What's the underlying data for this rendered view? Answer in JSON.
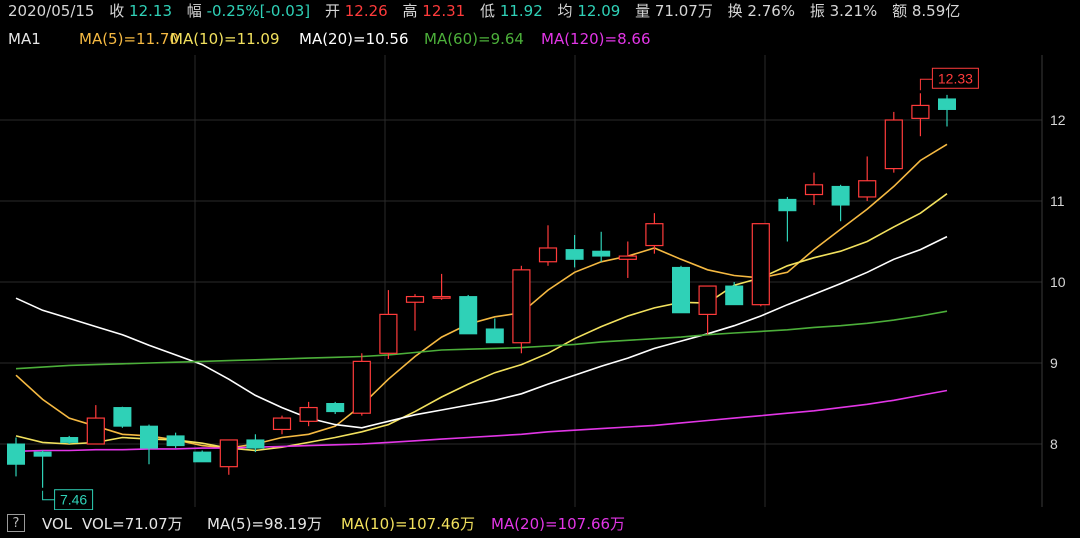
{
  "header": {
    "date": "2020/05/15",
    "close_label": "收",
    "close": "12.13",
    "change_label": "幅",
    "change": "-0.25%[-0.03]",
    "open_label": "开",
    "open": "12.26",
    "high_label": "高",
    "high": "12.31",
    "low_label": "低",
    "low": "11.92",
    "avg_label": "均",
    "avg": "12.09",
    "volume_label": "量",
    "volume": "71.07万",
    "turnover_label": "换",
    "turnover": "2.76%",
    "amplitude_label": "振",
    "amplitude": "3.21%",
    "amount_label": "额",
    "amount": "8.59亿"
  },
  "ma_row": {
    "name": "MA1",
    "ma5": "MA(5)=11.70",
    "ma10": "MA(10)=11.09",
    "ma20": "MA(20)=10.56",
    "ma60": "MA(60)=9.64",
    "ma120": "MA(120)=8.66"
  },
  "vol_row": {
    "help": "?",
    "name": "VOL",
    "vol": "VOL=71.07万",
    "ma5": "MA(5)=98.19万",
    "ma10": "MA(10)=107.46万",
    "ma20": "MA(20)=107.66万"
  },
  "colors": {
    "up": "#ff3b3b",
    "down": "#2fd1b7",
    "ma5": "#f5b942",
    "ma10": "#f2e15e",
    "ma20": "#ffffff",
    "ma60": "#4caf3a",
    "ma120": "#e236e6",
    "grid": "#2a2a2a"
  },
  "chart_data": {
    "type": "candlestick",
    "y_ticks": [
      "8",
      "9",
      "10",
      "11",
      "12"
    ],
    "ylim": [
      7.15,
      12.9
    ],
    "max_marker": "12.33",
    "min_marker": "7.46",
    "candles": [
      {
        "o": 8.0,
        "h": 8.08,
        "l": 7.6,
        "c": 7.75
      },
      {
        "o": 7.9,
        "h": 7.92,
        "l": 7.46,
        "c": 7.85
      },
      {
        "o": 8.08,
        "h": 8.1,
        "l": 8.0,
        "c": 8.02
      },
      {
        "o": 8.0,
        "h": 8.48,
        "l": 8.0,
        "c": 8.32
      },
      {
        "o": 8.45,
        "h": 8.46,
        "l": 8.2,
        "c": 8.22
      },
      {
        "o": 8.22,
        "h": 8.24,
        "l": 7.75,
        "c": 7.95
      },
      {
        "o": 8.1,
        "h": 8.14,
        "l": 7.95,
        "c": 7.98
      },
      {
        "o": 7.9,
        "h": 7.92,
        "l": 7.78,
        "c": 7.78
      },
      {
        "o": 7.72,
        "h": 8.05,
        "l": 7.62,
        "c": 8.05
      },
      {
        "o": 8.05,
        "h": 8.12,
        "l": 7.9,
        "c": 7.95
      },
      {
        "o": 8.18,
        "h": 8.35,
        "l": 8.12,
        "c": 8.32
      },
      {
        "o": 8.28,
        "h": 8.52,
        "l": 8.22,
        "c": 8.45
      },
      {
        "o": 8.5,
        "h": 8.52,
        "l": 8.37,
        "c": 8.4
      },
      {
        "o": 8.38,
        "h": 9.12,
        "l": 8.35,
        "c": 9.02
      },
      {
        "o": 9.12,
        "h": 9.9,
        "l": 9.05,
        "c": 9.6
      },
      {
        "o": 9.75,
        "h": 9.85,
        "l": 9.4,
        "c": 9.82
      },
      {
        "o": 9.8,
        "h": 10.1,
        "l": 9.78,
        "c": 9.82
      },
      {
        "o": 9.82,
        "h": 9.84,
        "l": 9.36,
        "c": 9.36
      },
      {
        "o": 9.42,
        "h": 9.55,
        "l": 9.28,
        "c": 9.25
      },
      {
        "o": 9.25,
        "h": 10.2,
        "l": 9.12,
        "c": 10.15
      },
      {
        "o": 10.25,
        "h": 10.7,
        "l": 10.2,
        "c": 10.42
      },
      {
        "o": 10.4,
        "h": 10.58,
        "l": 10.18,
        "c": 10.28
      },
      {
        "o": 10.38,
        "h": 10.62,
        "l": 10.25,
        "c": 10.32
      },
      {
        "o": 10.28,
        "h": 10.5,
        "l": 10.05,
        "c": 10.32
      },
      {
        "o": 10.45,
        "h": 10.85,
        "l": 10.35,
        "c": 10.72
      },
      {
        "o": 10.18,
        "h": 10.2,
        "l": 9.62,
        "c": 9.62
      },
      {
        "o": 9.6,
        "h": 9.95,
        "l": 9.35,
        "c": 9.95
      },
      {
        "o": 9.95,
        "h": 10.0,
        "l": 9.72,
        "c": 9.72
      },
      {
        "o": 9.72,
        "h": 10.72,
        "l": 9.7,
        "c": 10.72
      },
      {
        "o": 11.02,
        "h": 11.05,
        "l": 10.5,
        "c": 10.88
      },
      {
        "o": 11.08,
        "h": 11.35,
        "l": 10.95,
        "c": 11.2
      },
      {
        "o": 11.18,
        "h": 11.2,
        "l": 10.75,
        "c": 10.95
      },
      {
        "o": 11.05,
        "h": 11.55,
        "l": 11.0,
        "c": 11.25
      },
      {
        "o": 11.4,
        "h": 12.1,
        "l": 11.35,
        "c": 12.0
      },
      {
        "o": 12.02,
        "h": 12.33,
        "l": 11.8,
        "c": 12.18
      },
      {
        "o": 12.26,
        "h": 12.31,
        "l": 11.92,
        "c": 12.13
      }
    ],
    "series": [
      {
        "name": "MA(5)",
        "key": "ma5",
        "values": [
          8.85,
          8.55,
          8.32,
          8.22,
          8.12,
          8.1,
          8.05,
          7.98,
          7.95,
          8.0,
          8.08,
          8.12,
          8.22,
          8.48,
          8.8,
          9.08,
          9.32,
          9.48,
          9.57,
          9.62,
          9.9,
          10.12,
          10.25,
          10.32,
          10.42,
          10.28,
          10.15,
          10.08,
          10.05,
          10.12,
          10.4,
          10.65,
          10.9,
          11.18,
          11.5,
          11.7
        ]
      },
      {
        "name": "MA(10)",
        "key": "ma10",
        "values": [
          8.1,
          8.02,
          8.0,
          8.02,
          8.08,
          8.06,
          8.05,
          8.01,
          7.95,
          7.92,
          7.96,
          8.02,
          8.08,
          8.15,
          8.24,
          8.4,
          8.58,
          8.74,
          8.88,
          8.98,
          9.12,
          9.3,
          9.45,
          9.58,
          9.68,
          9.75,
          9.74,
          9.96,
          10.05,
          10.2,
          10.3,
          10.38,
          10.5,
          10.68,
          10.85,
          11.09
        ]
      },
      {
        "name": "MA(20)",
        "key": "ma20",
        "values": [
          9.8,
          9.65,
          9.55,
          9.45,
          9.35,
          9.22,
          9.1,
          8.98,
          8.8,
          8.6,
          8.45,
          8.32,
          8.24,
          8.2,
          8.28,
          8.36,
          8.42,
          8.48,
          8.54,
          8.62,
          8.74,
          8.85,
          8.96,
          9.06,
          9.18,
          9.27,
          9.36,
          9.46,
          9.58,
          9.72,
          9.85,
          9.98,
          10.12,
          10.28,
          10.4,
          10.56
        ]
      },
      {
        "name": "MA(60)",
        "key": "ma60",
        "values": [
          8.93,
          8.95,
          8.97,
          8.98,
          8.99,
          9.0,
          9.01,
          9.02,
          9.03,
          9.04,
          9.05,
          9.06,
          9.07,
          9.08,
          9.1,
          9.13,
          9.16,
          9.17,
          9.18,
          9.19,
          9.21,
          9.23,
          9.26,
          9.28,
          9.3,
          9.32,
          9.35,
          9.37,
          9.39,
          9.41,
          9.44,
          9.46,
          9.49,
          9.53,
          9.58,
          9.64
        ]
      },
      {
        "name": "MA(120)",
        "key": "ma120",
        "values": [
          7.91,
          7.92,
          7.92,
          7.93,
          7.93,
          7.94,
          7.94,
          7.95,
          7.95,
          7.96,
          7.97,
          7.98,
          7.99,
          8.0,
          8.02,
          8.04,
          8.06,
          8.08,
          8.1,
          8.12,
          8.15,
          8.17,
          8.19,
          8.21,
          8.23,
          8.26,
          8.29,
          8.32,
          8.35,
          8.38,
          8.41,
          8.45,
          8.49,
          8.54,
          8.6,
          8.66
        ]
      }
    ]
  }
}
